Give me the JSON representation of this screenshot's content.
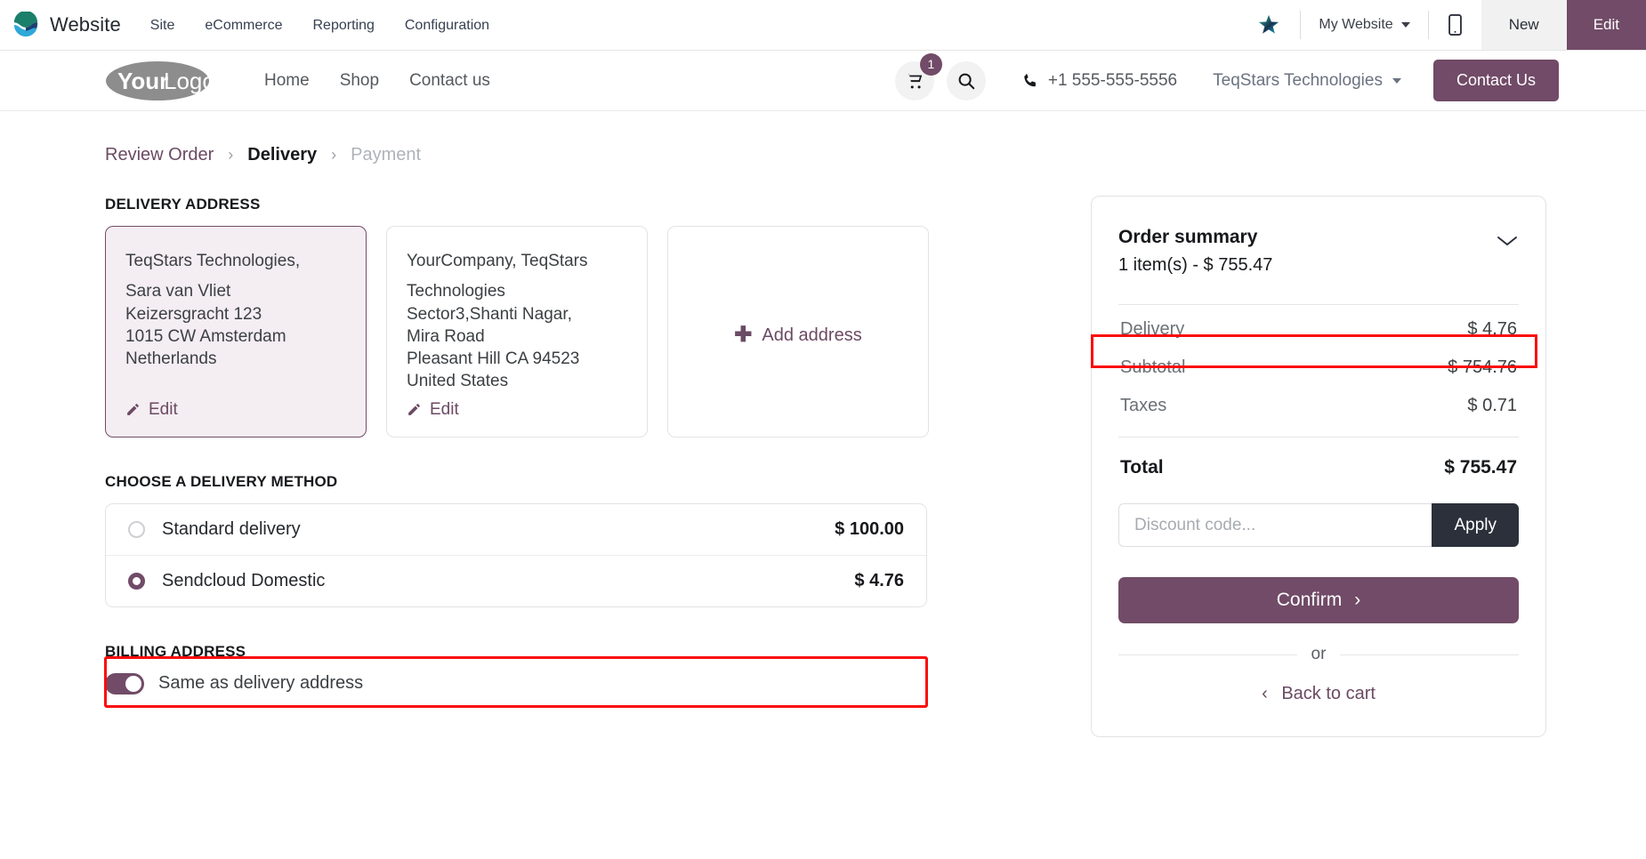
{
  "backend": {
    "brand": "Website",
    "menu": [
      "Site",
      "eCommerce",
      "Reporting",
      "Configuration"
    ],
    "website_selector": "My Website",
    "new_label": "New",
    "edit_label": "Edit",
    "accent": "#714b67"
  },
  "site_nav": {
    "logo_your": "Your",
    "logo_logo": "Logo",
    "links": [
      "Home",
      "Shop",
      "Contact us"
    ],
    "cart_count": "1",
    "phone": "+1 555-555-5556",
    "account": "TeqStars Technologies",
    "contact_button": "Contact Us"
  },
  "breadcrumb": {
    "review_order": "Review Order",
    "delivery": "Delivery",
    "payment": "Payment",
    "separator": "›"
  },
  "delivery_address": {
    "title": "DELIVERY ADDRESS",
    "cards": [
      {
        "selected": true,
        "lines": [
          "TeqStars Technologies,",
          "Sara van Vliet",
          "Keizersgracht 123",
          "1015 CW Amsterdam",
          "Netherlands"
        ],
        "edit_label": "Edit"
      },
      {
        "selected": false,
        "lines": [
          "YourCompany, TeqStars",
          "Technologies",
          "Sector3,Shanti Nagar,",
          "Mira Road",
          "Pleasant Hill CA 94523",
          "United States"
        ],
        "edit_label": "Edit"
      }
    ],
    "add_label": "Add address"
  },
  "delivery_method": {
    "title": "CHOOSE A DELIVERY METHOD",
    "options": [
      {
        "label": "Standard delivery",
        "price": "$ 100.00",
        "selected": false,
        "highlighted": false
      },
      {
        "label": "Sendcloud Domestic",
        "price": "$ 4.76",
        "selected": true,
        "highlighted": true
      }
    ]
  },
  "billing_address": {
    "title": "BILLING ADDRESS",
    "toggle_label": "Same as delivery address",
    "toggle_on": true
  },
  "order_summary": {
    "title": "Order summary",
    "subtitle": "1 item(s) -  $ 755.47",
    "lines": [
      {
        "label": "Delivery",
        "value": "$ 4.76",
        "highlighted": true
      },
      {
        "label": "Subtotal",
        "value": "$ 754.76",
        "highlighted": false
      },
      {
        "label": "Taxes",
        "value": "$ 0.71",
        "highlighted": false
      }
    ],
    "total_label": "Total",
    "total_value": "$ 755.47",
    "discount_placeholder": "Discount code...",
    "discount_value": "",
    "apply_label": "Apply",
    "confirm_label": "Confirm",
    "or_label": "or",
    "back_label": "Back to cart"
  }
}
